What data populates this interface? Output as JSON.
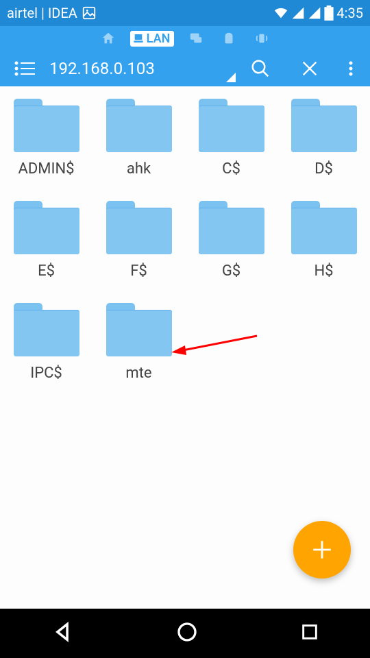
{
  "status": {
    "carrier": "airtel | IDEA",
    "time": "4:35"
  },
  "iconbar": {
    "lan_label": "LAN"
  },
  "appbar": {
    "address": "192.168.0.103"
  },
  "folders": [
    {
      "label": "ADMIN$"
    },
    {
      "label": "ahk"
    },
    {
      "label": "C$"
    },
    {
      "label": "D$"
    },
    {
      "label": "E$"
    },
    {
      "label": "F$"
    },
    {
      "label": "G$"
    },
    {
      "label": "H$"
    },
    {
      "label": "IPC$"
    },
    {
      "label": "mte"
    }
  ],
  "colors": {
    "primary": "#33a1ee",
    "statusbar": "#2089d6",
    "fab": "#ffa400",
    "folder": "#83c6f2"
  }
}
